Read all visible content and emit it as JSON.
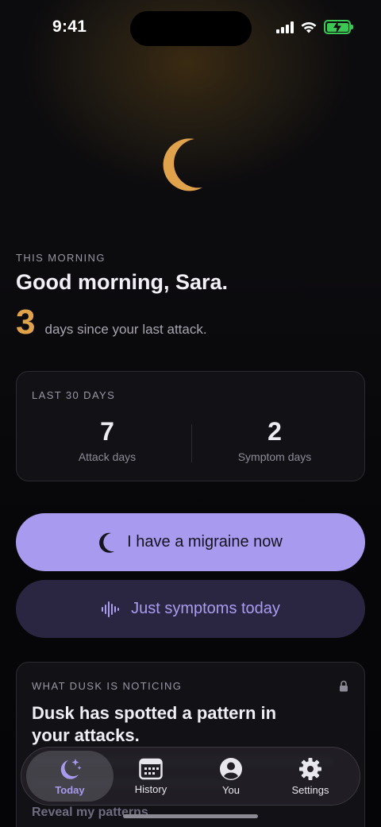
{
  "status_bar": {
    "time": "9:41"
  },
  "today": {
    "eyebrow": "THIS MORNING",
    "greeting": "Good morning, Sara.",
    "streak_days": "3",
    "streak_text": "days since your last attack."
  },
  "stats": {
    "label": "LAST 30 DAYS",
    "attack_days": {
      "value": "7",
      "label": "Attack days"
    },
    "symptom_days": {
      "value": "2",
      "label": "Symptom days"
    }
  },
  "actions": {
    "migraine_label": "I have a migraine now",
    "symptoms_label": "Just symptoms today"
  },
  "insight": {
    "label": "WHAT DUSK IS NOTICING",
    "title": "Dusk has spotted a pattern in your attacks.",
    "reveal_label": "Reveal my patterns"
  },
  "tabs": [
    {
      "label": "Today",
      "icon": "moon-stars-icon",
      "active": true
    },
    {
      "label": "History",
      "icon": "calendar-icon",
      "active": false
    },
    {
      "label": "You",
      "icon": "person-icon",
      "active": false
    },
    {
      "label": "Settings",
      "icon": "gear-icon",
      "active": false
    }
  ],
  "colors": {
    "accent": "#a89bef",
    "streak": "#E0A24A",
    "battery": "#3cc653"
  }
}
